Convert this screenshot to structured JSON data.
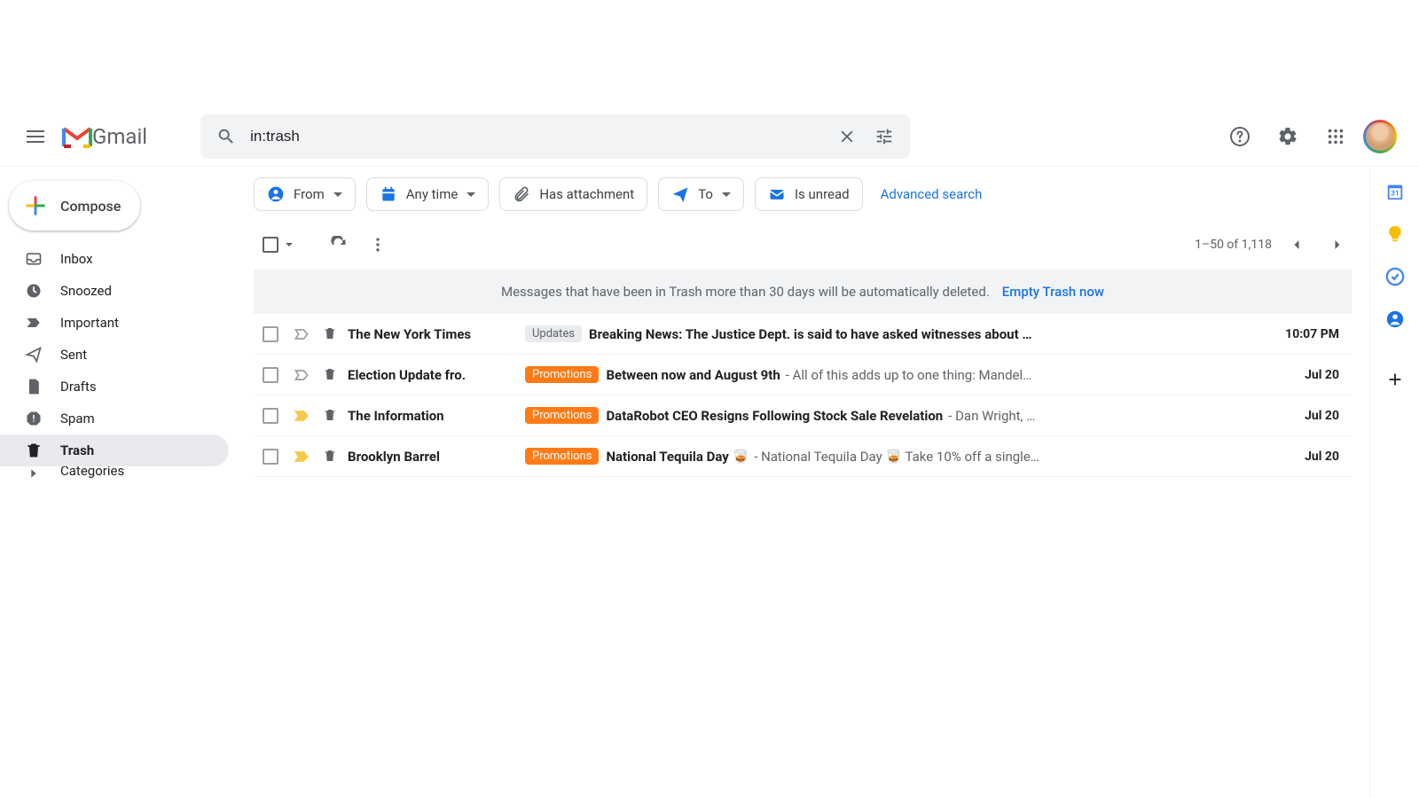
{
  "header": {
    "product_name": "Gmail",
    "search_value": "in:trash"
  },
  "compose_label": "Compose",
  "sidebar": {
    "items": [
      {
        "label": "Inbox",
        "icon": "inbox"
      },
      {
        "label": "Snoozed",
        "icon": "clock"
      },
      {
        "label": "Important",
        "icon": "bookmark"
      },
      {
        "label": "Sent",
        "icon": "send"
      },
      {
        "label": "Drafts",
        "icon": "file"
      },
      {
        "label": "Spam",
        "icon": "spam"
      },
      {
        "label": "Trash",
        "icon": "trash",
        "active": true
      },
      {
        "label": "Categories",
        "icon": "chevron"
      }
    ]
  },
  "filters": {
    "from": "From",
    "any_time": "Any time",
    "has_attachment": "Has attachment",
    "to": "To",
    "is_unread": "Is unread",
    "advanced": "Advanced search"
  },
  "pagination": {
    "label": "1–50 of 1,118"
  },
  "banner": {
    "text": "Messages that have been in Trash more than 30 days will be automatically deleted.",
    "action": "Empty Trash now"
  },
  "emails": [
    {
      "sender": "The New York Times",
      "tag": "Updates",
      "tag_type": "updates",
      "subject": "Breaking News: The Justice Dept. is said to have asked witnesses about …",
      "snippet": "",
      "time": "10:07 PM",
      "important": false
    },
    {
      "sender": "Election Update fro.",
      "tag": "Promotions",
      "tag_type": "promo",
      "subject": "Between now and August 9th",
      "snippet": " - All of this adds up to one thing: Mandel…",
      "time": "Jul 20",
      "important": false
    },
    {
      "sender": "The Information",
      "tag": "Promotions",
      "tag_type": "promo",
      "subject": "DataRobot CEO Resigns Following Stock Sale Revelation",
      "snippet": " - Dan Wright, …",
      "time": "Jul 20",
      "important": true
    },
    {
      "sender": "Brooklyn Barrel",
      "tag": "Promotions",
      "tag_type": "promo",
      "subject": "National Tequila Day 🥃",
      "snippet": " - National Tequila Day 🥃 Take 10% off a single…",
      "time": "Jul 20",
      "important": true
    }
  ],
  "side_apps": [
    "calendar",
    "keep",
    "tasks",
    "contacts",
    "add"
  ]
}
